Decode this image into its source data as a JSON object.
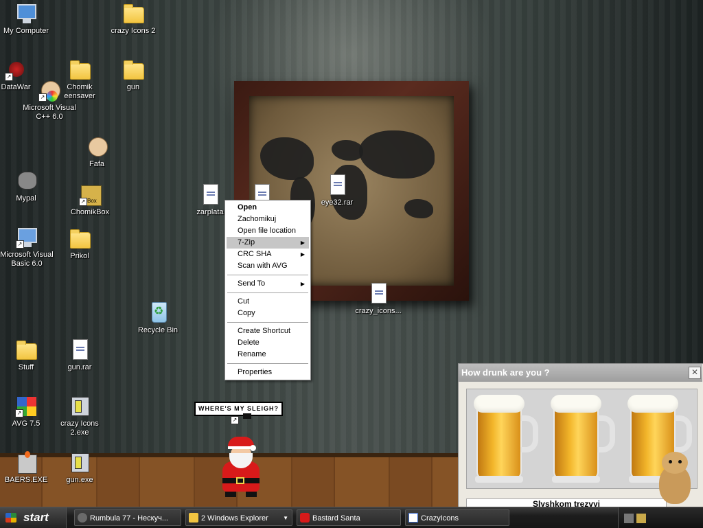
{
  "desktop": {
    "icons": {
      "my_computer": "My Computer",
      "crazy_icons_2": "crazy Icons 2",
      "datawar": "DataWar",
      "chomik_screensaver_1": "Chomik",
      "chomik_screensaver_2": "eensaver",
      "gun": "gun",
      "ms_visual_cpp_1": "Microsoft Visual",
      "ms_visual_cpp_2": "C++ 6.0",
      "fafa": "Fafa",
      "mypal": "Mypal",
      "chomikbox": "ChomikBox",
      "zarplata": "zarplata",
      "eye32": "eye32.rar",
      "ms_visual_basic_1": "Microsoft Visual",
      "ms_visual_basic_2": "Basic 6.0",
      "prikol": "Prikol",
      "crazy_icons_rar": "crazy_icons...",
      "recycle_bin": "Recycle Bin",
      "stuff": "Stuff",
      "gun_rar": "gun.rar",
      "avg": "AVG 7.5",
      "crazy_icons_2_exe_1": "crazy Icons",
      "crazy_icons_2_exe_2": "2.exe",
      "baers": "BAERS.EXE",
      "gun_exe": "gun.exe"
    },
    "chomikbox_badge": "Box",
    "sleigh_bubble": "WHERE'S MY SLEIGH?"
  },
  "context_menu": {
    "items": [
      {
        "label": "Open",
        "bold": true
      },
      {
        "label": "Zachomikuj"
      },
      {
        "label": "Open file location"
      },
      {
        "label": "7-Zip",
        "submenu": true,
        "highlighted": true
      },
      {
        "label": "CRC SHA",
        "submenu": true
      },
      {
        "label": "Scan with AVG"
      },
      {
        "label": "Send To",
        "submenu": true
      },
      {
        "label": "Cut"
      },
      {
        "label": "Copy"
      },
      {
        "label": "Create Shortcut"
      },
      {
        "label": "Delete"
      },
      {
        "label": "Rename"
      },
      {
        "label": "Properties"
      }
    ],
    "highlight_color": "#c6c6c6"
  },
  "drunk_window": {
    "title": "How drunk are you ?",
    "close_icon": "close-icon",
    "message": "Slyshkom trezvyi"
  },
  "taskbar": {
    "start_label": "start",
    "tasks": [
      {
        "label": "Rumbula 77 - Нескуч...",
        "icon": "winamp-icon"
      },
      {
        "label": "2 Windows Explorer",
        "icon": "folder-icon",
        "group": true
      },
      {
        "label": "Bastard Santa",
        "icon": "santa-icon"
      },
      {
        "label": "CrazyIcons",
        "icon": "window-icon"
      }
    ]
  },
  "colors": {
    "wall": "#3c4542",
    "floor": "#7a4a22",
    "taskbar": "#1d1d1d",
    "menu_bg": "#ffffff"
  }
}
